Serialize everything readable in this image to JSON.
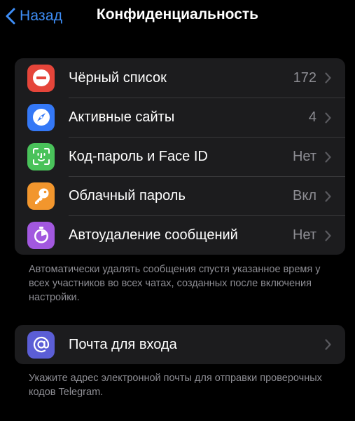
{
  "nav": {
    "back_label": "Назад",
    "title": "Конфиденциальность"
  },
  "privacy_group": {
    "items": [
      {
        "label": "Чёрный список",
        "value": "172",
        "icon": "blocked-icon",
        "color": "#e5453a"
      },
      {
        "label": "Активные сайты",
        "value": "4",
        "icon": "compass-icon",
        "color": "#3478f6"
      },
      {
        "label": "Код-пароль и Face ID",
        "value": "Нет",
        "icon": "face-id-icon",
        "color": "#49c25a"
      },
      {
        "label": "Облачный пароль",
        "value": "Вкл",
        "icon": "key-icon",
        "color": "#f2962d"
      },
      {
        "label": "Автоудаление сообщений",
        "value": "Нет",
        "icon": "timer-icon",
        "color": "#a258df"
      }
    ],
    "footnote": "Автоматически удалять сообщения спустя указанное время у всех участников во всех чатах, созданных после включения настройки."
  },
  "email_group": {
    "items": [
      {
        "label": "Почта для входа",
        "value": "",
        "icon": "at-sign-icon",
        "color": "#5b5ed6"
      }
    ],
    "footnote": "Укажите адрес электронной почты для отправки проверочных кодов Telegram."
  },
  "colors": {
    "accent": "#3e8ef7",
    "background": "#000000",
    "cell_background": "#1c1c1e",
    "secondary_text": "#8d8d93"
  }
}
